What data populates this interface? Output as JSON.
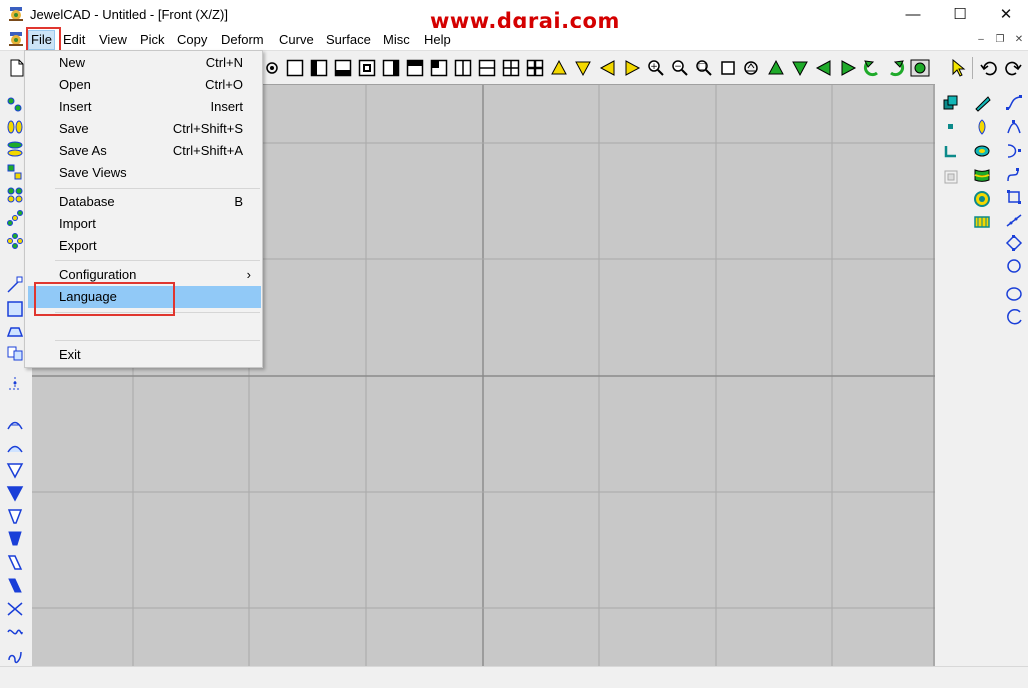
{
  "window": {
    "title": "JewelCAD - Untitled - [Front (X/Z)]",
    "watermark": "www.dgrai.com",
    "minimize": "—",
    "maximize": "☐",
    "close": "✕"
  },
  "menubar": {
    "items": [
      "File",
      "Edit",
      "View",
      "Pick",
      "Copy",
      "Deform",
      "Curve",
      "Surface",
      "Misc",
      "Help"
    ],
    "mdi_minimize": "–",
    "mdi_restore": "❐",
    "mdi_close": "✕"
  },
  "file_menu": {
    "items": [
      {
        "label": "New",
        "shortcut": "Ctrl+N"
      },
      {
        "label": "Open",
        "shortcut": "Ctrl+O"
      },
      {
        "label": "Insert",
        "shortcut": "Insert"
      },
      {
        "label": "Save",
        "shortcut": "Ctrl+Shift+S"
      },
      {
        "label": "Save As",
        "shortcut": "Ctrl+Shift+A"
      },
      {
        "label": "Save Views",
        "shortcut": ""
      },
      {
        "label": "Database",
        "shortcut": "B"
      },
      {
        "label": "Import",
        "shortcut": ""
      },
      {
        "label": "Export",
        "shortcut": ""
      },
      {
        "label": "Configuration",
        "shortcut": "›"
      },
      {
        "label": "Language",
        "shortcut": ""
      },
      {
        "label": "Exit",
        "shortcut": ""
      }
    ],
    "highlighted": "Language"
  },
  "colors": {
    "viewport_bg": "#c8c8c8",
    "grid_line": "#a9a9a9",
    "menu_highlight": "#91c9f7",
    "annotation_red": "#e0362f",
    "icon_blue": "#1a3fd8",
    "icon_green": "#1faa2a",
    "icon_yellow": "#f3d800"
  }
}
